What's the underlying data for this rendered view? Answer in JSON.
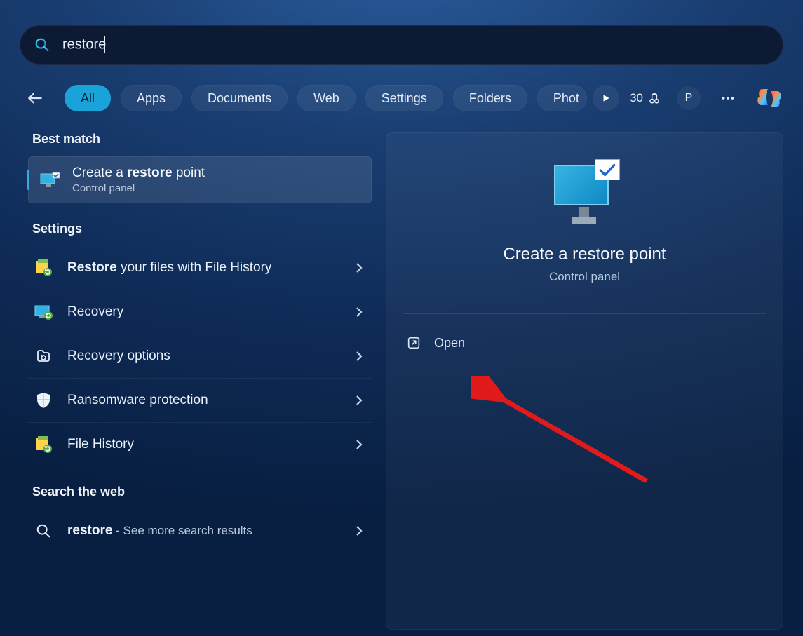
{
  "search": {
    "value": "restore"
  },
  "tabs": [
    "All",
    "Apps",
    "Documents",
    "Web",
    "Settings",
    "Folders",
    "Phot"
  ],
  "active_tab": 0,
  "points": "30",
  "profile_initial": "P",
  "sections": {
    "best_match": "Best match",
    "settings": "Settings",
    "search_web": "Search the web"
  },
  "best_match_item": {
    "prefix": "Create a ",
    "highlight": "restore",
    "suffix": " point",
    "subtitle": "Control panel"
  },
  "settings_items": [
    {
      "bold": "Restore",
      "rest": " your files with File History",
      "icon": "file-history"
    },
    {
      "bold": "",
      "rest": "Recovery",
      "icon": "recovery-monitor"
    },
    {
      "bold": "",
      "rest": "Recovery options",
      "icon": "recovery-options"
    },
    {
      "bold": "",
      "rest": "Ransomware protection",
      "icon": "shield"
    },
    {
      "bold": "",
      "rest": "File History",
      "icon": "file-history"
    }
  ],
  "web_item": {
    "bold": "restore",
    "sub": " - See more search results"
  },
  "preview": {
    "title": "Create a restore point",
    "subtitle": "Control panel",
    "open_label": "Open"
  }
}
